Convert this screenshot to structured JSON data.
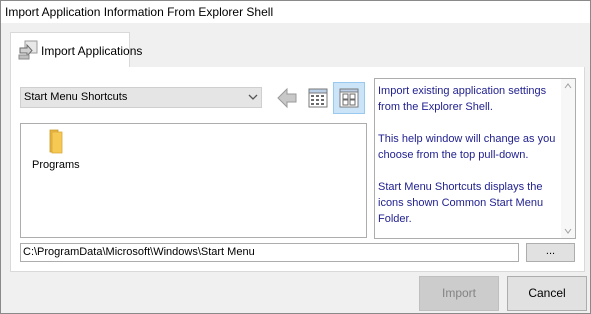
{
  "window": {
    "title": "Import Application Information From Explorer Shell"
  },
  "tabs": [
    {
      "label": "Import Applications",
      "icon": "import-arrow-icon",
      "selected": true
    }
  ],
  "source_select": {
    "value": "Start Menu Shortcuts"
  },
  "toolbar": {
    "back_icon": "back-arrow-icon",
    "view1_icon": "details-view-icon",
    "view2_icon": "icons-view-icon"
  },
  "items": [
    {
      "label": "Programs",
      "icon": "folder-icon"
    }
  ],
  "help": {
    "paragraphs": [
      "Import existing application settings from the Explorer Shell.",
      "This help window will change as you choose from the top pull-down.",
      "Start Menu Shortcuts displays the icons shown Common Start Menu Folder."
    ]
  },
  "path": {
    "value": "C:\\ProgramData\\Microsoft\\Windows\\Start Menu"
  },
  "browse_label": "...",
  "buttons": {
    "import": "Import",
    "cancel": "Cancel"
  },
  "colors": {
    "help_text": "#1f1f8f",
    "selected_view": "#cce4f7",
    "folder": "#f6c955"
  }
}
